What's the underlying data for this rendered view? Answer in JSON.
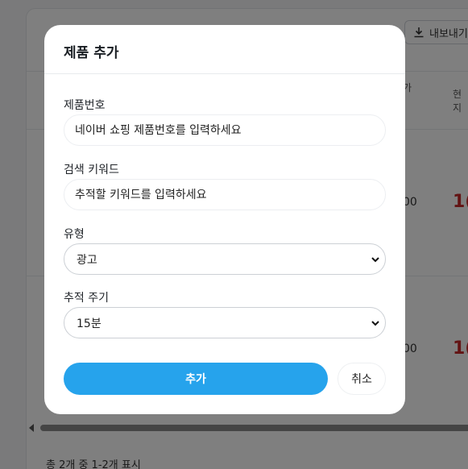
{
  "background": {
    "export_label": "내보내기",
    "column_headers": [
      "가",
      "현지"
    ],
    "row_values": [
      "00",
      "00"
    ],
    "row_highlights": [
      "1(",
      "1("
    ],
    "footer_text": "총 2개 중 1-2개 표시"
  },
  "modal": {
    "title": "제품 추가",
    "fields": {
      "product_id": {
        "label": "제품번호",
        "placeholder": "네이버 쇼핑 제품번호를 입력하세요"
      },
      "keyword": {
        "label": "검색 키워드",
        "placeholder": "추적할 키워드를 입력하세요"
      },
      "type": {
        "label": "유형",
        "value": "광고"
      },
      "interval": {
        "label": "추적 주기",
        "value": "15분"
      }
    },
    "add_label": "추가",
    "cancel_label": "취소"
  },
  "colors": {
    "primary": "#26a3ec",
    "danger": "#c62828"
  }
}
